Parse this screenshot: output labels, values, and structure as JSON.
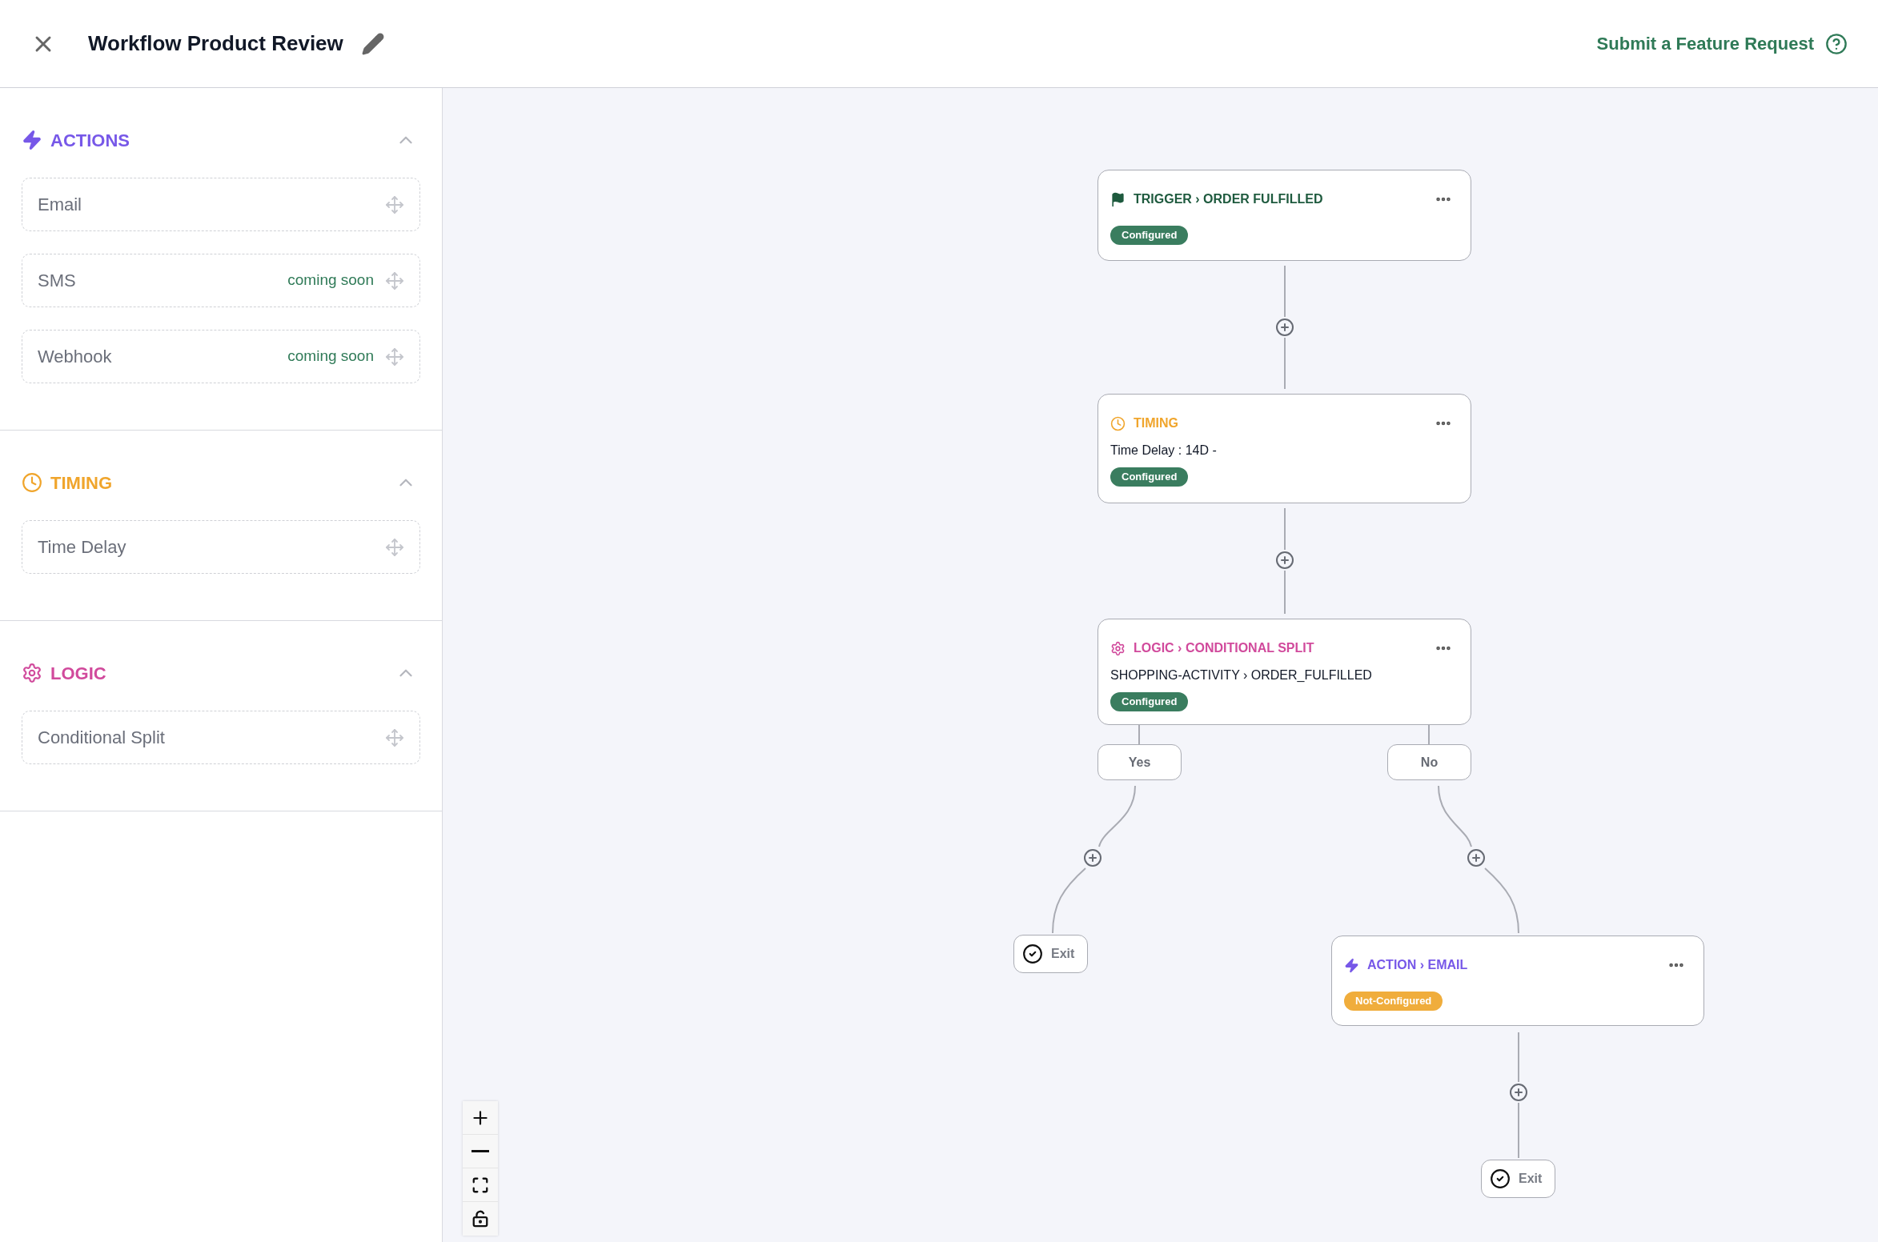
{
  "header": {
    "title": "Workflow Product Review",
    "feature_request": "Submit a Feature Request"
  },
  "sidebar": {
    "sections": [
      {
        "kind": "actions",
        "title": "ACTIONS",
        "expanded": true,
        "items": [
          {
            "label": "Email"
          },
          {
            "label": "SMS",
            "note": "coming soon"
          },
          {
            "label": "Webhook",
            "note": "coming soon"
          }
        ]
      },
      {
        "kind": "timing",
        "title": "TIMING",
        "expanded": true,
        "items": [
          {
            "label": "Time Delay"
          }
        ]
      },
      {
        "kind": "logic",
        "title": "LOGIC",
        "expanded": true,
        "items": [
          {
            "label": "Conditional Split"
          }
        ]
      }
    ]
  },
  "canvas": {
    "nodes": [
      {
        "kind": "trigger",
        "title": "TRIGGER › ORDER FULFILLED",
        "status": "Configured",
        "configured": true
      },
      {
        "kind": "timing",
        "title": "TIMING",
        "detail": "Time Delay : 14D -",
        "status": "Configured",
        "configured": true
      },
      {
        "kind": "logic",
        "title": "LOGIC › CONDITIONAL SPLIT",
        "detail": "SHOPPING-ACTIVITY › ORDER_FULFILLED",
        "status": "Configured",
        "configured": true
      },
      {
        "kind": "action",
        "title": "ACTION › EMAIL",
        "status": "Not-Configured",
        "configured": false
      }
    ],
    "branches": [
      {
        "label": "Yes"
      },
      {
        "label": "No"
      }
    ],
    "exits": [
      {
        "label": "Exit"
      },
      {
        "label": "Exit"
      }
    ]
  }
}
